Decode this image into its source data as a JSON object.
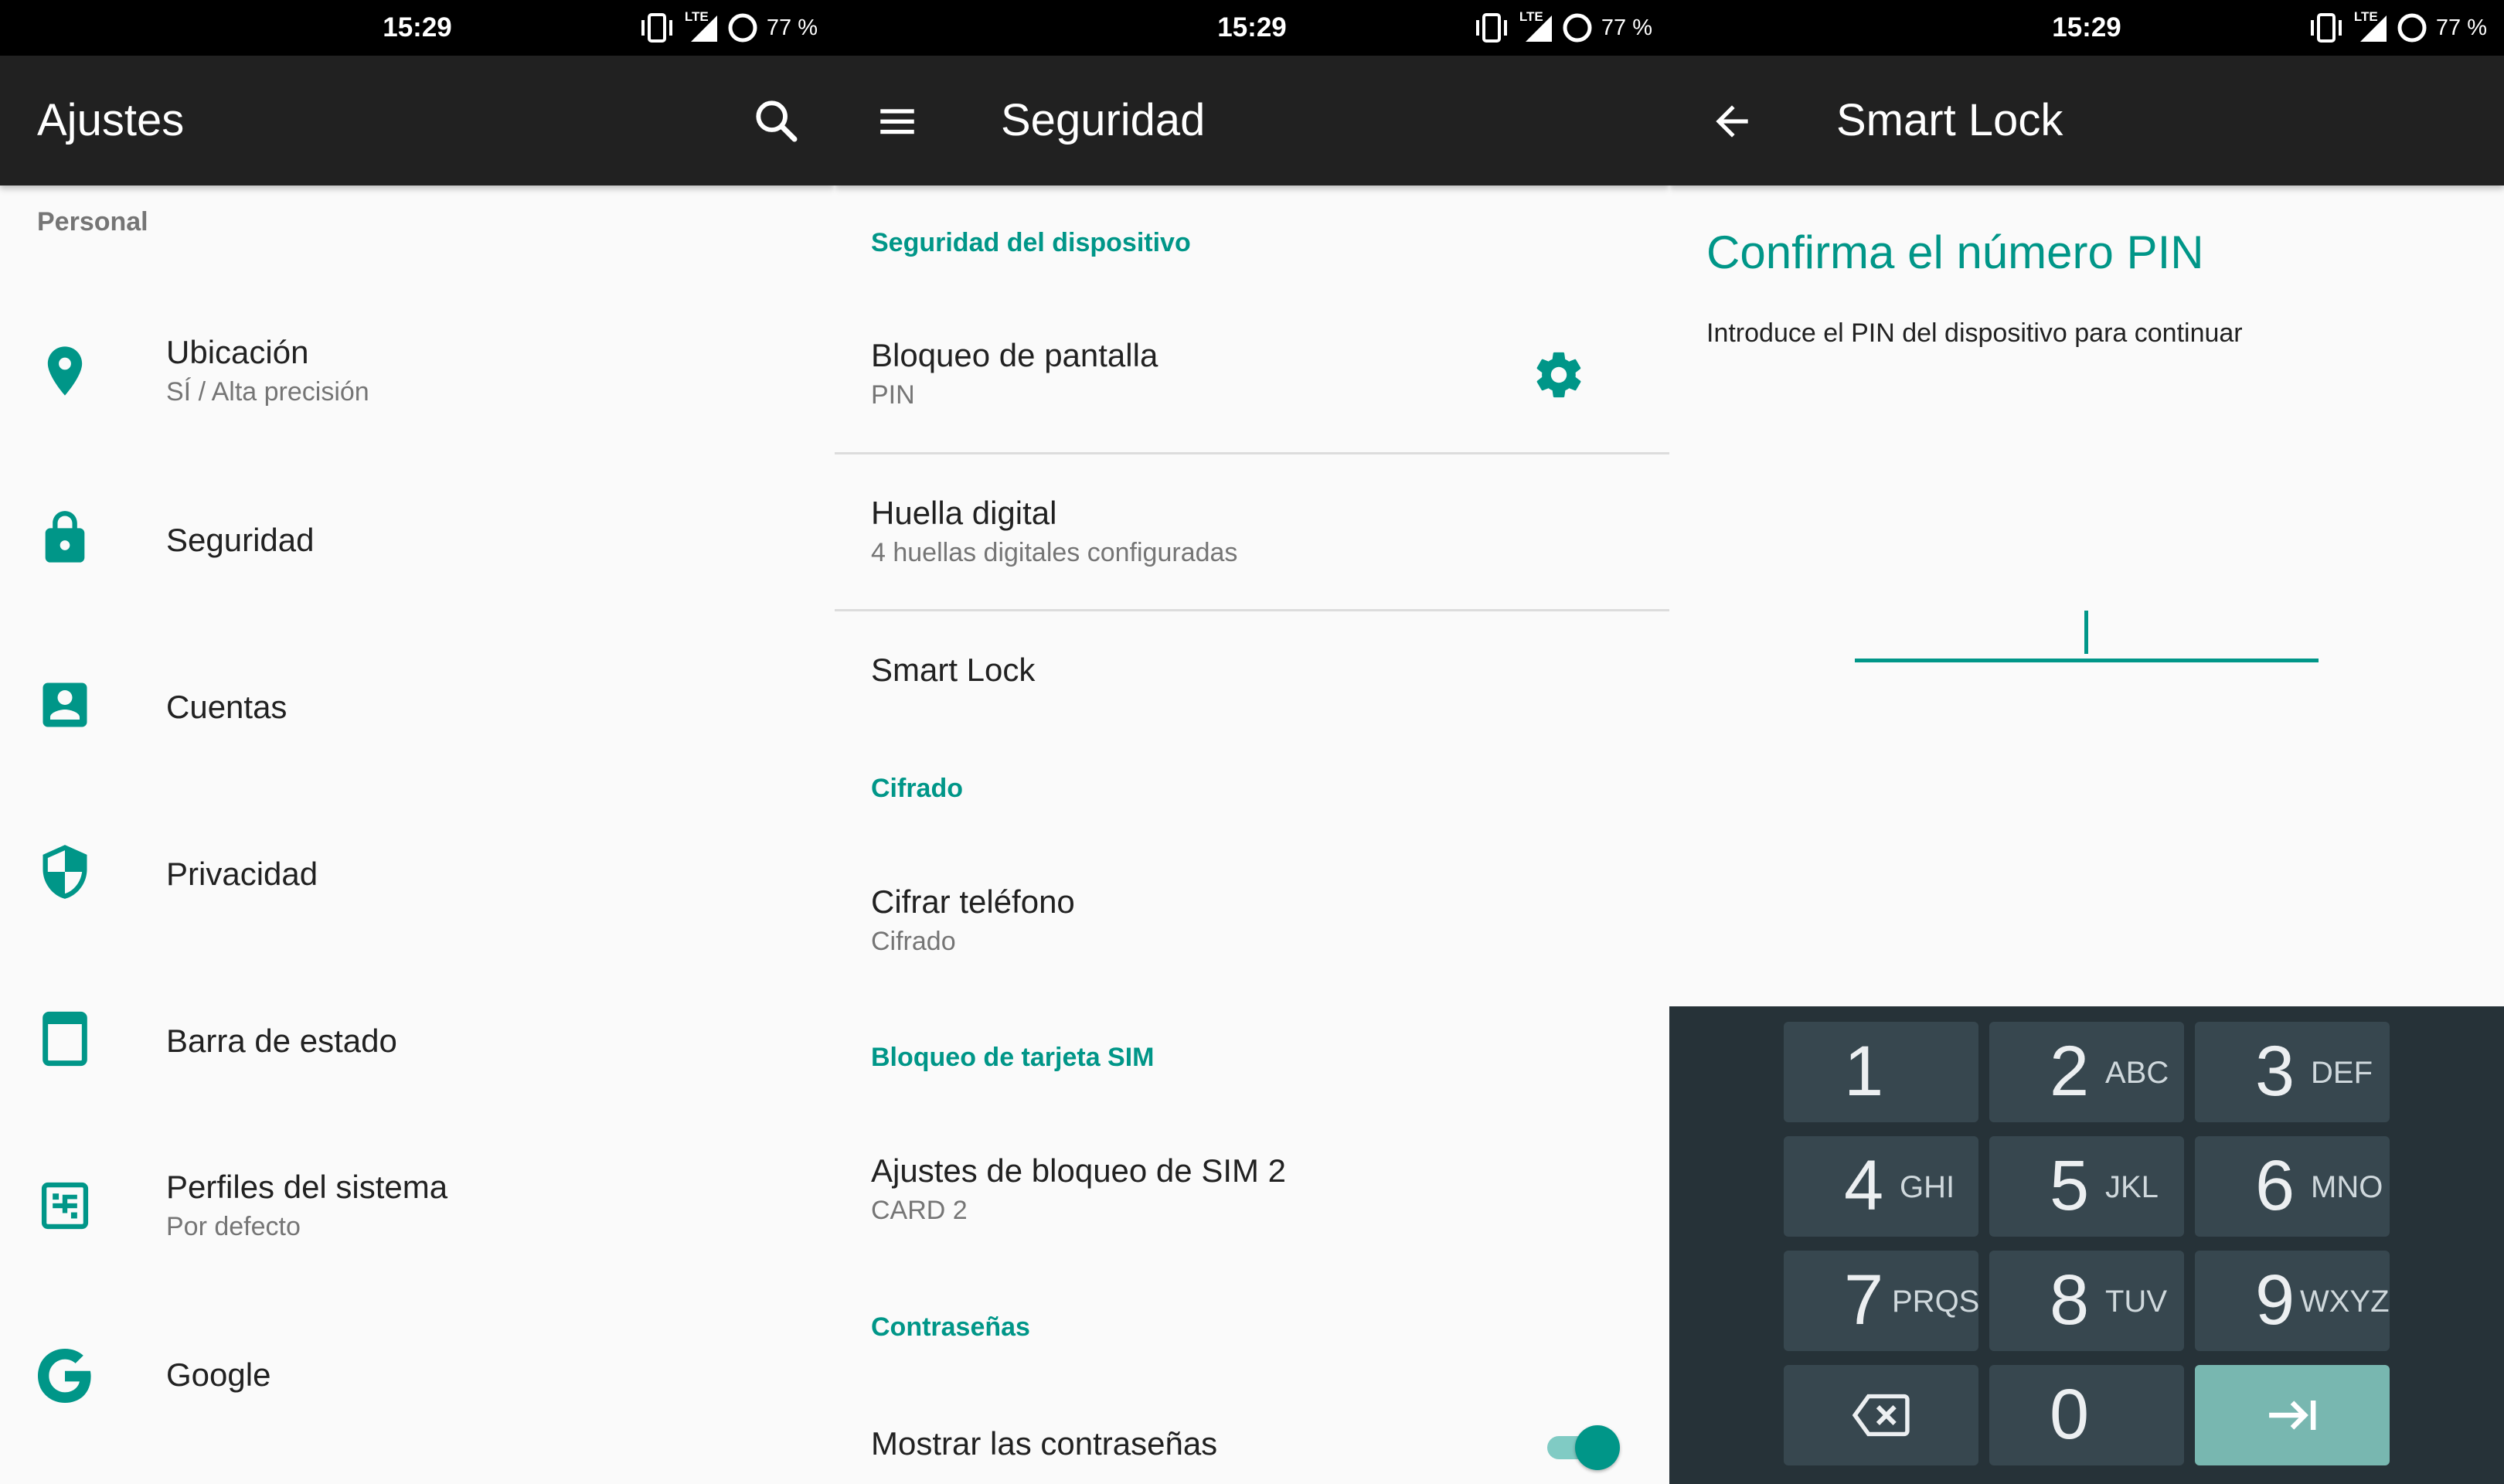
{
  "status_bar": {
    "time": "15:29",
    "network": "LTE",
    "battery": "77 %"
  },
  "panel1": {
    "title": "Ajustes",
    "section": "Personal",
    "items": [
      {
        "label": "Ubicación",
        "sub": "SÍ / Alta precisión",
        "icon": "location-pin-icon"
      },
      {
        "label": "Seguridad",
        "icon": "lock-icon"
      },
      {
        "label": "Cuentas",
        "icon": "account-box-icon"
      },
      {
        "label": "Privacidad",
        "icon": "shield-icon"
      },
      {
        "label": "Barra de estado",
        "icon": "status-bar-icon"
      },
      {
        "label": "Perfiles del sistema",
        "sub": "Por defecto",
        "icon": "profiles-icon"
      },
      {
        "label": "Google",
        "icon": "google-icon"
      }
    ]
  },
  "panel2": {
    "title": "Seguridad",
    "cat_device": "Seguridad del dispositivo",
    "screen_lock": {
      "label": "Bloqueo de pantalla",
      "sub": "PIN"
    },
    "fingerprint": {
      "label": "Huella digital",
      "sub": "4 huellas digitales configuradas"
    },
    "smart_lock": {
      "label": "Smart Lock"
    },
    "cat_encrypt": "Cifrado",
    "encrypt": {
      "label": "Cifrar teléfono",
      "sub": "Cifrado"
    },
    "cat_sim": "Bloqueo de tarjeta SIM",
    "sim": {
      "label": "Ajustes de bloqueo de SIM 2",
      "sub": "CARD 2"
    },
    "cat_pass": "Contraseñas",
    "show_pass": {
      "label": "Mostrar las contraseñas",
      "enabled": true
    }
  },
  "panel3": {
    "title": "Smart Lock",
    "heading": "Confirma el número PIN",
    "desc": "Introduce el PIN del dispositivo para continuar",
    "pin_value": "",
    "keys": [
      {
        "num": "1",
        "letters": ""
      },
      {
        "num": "2",
        "letters": "ABC"
      },
      {
        "num": "3",
        "letters": "DEF"
      },
      {
        "num": "4",
        "letters": "GHI"
      },
      {
        "num": "5",
        "letters": "JKL"
      },
      {
        "num": "6",
        "letters": "MNO"
      },
      {
        "num": "7",
        "letters": "PRQS"
      },
      {
        "num": "8",
        "letters": "TUV"
      },
      {
        "num": "9",
        "letters": "WXYZ"
      },
      {
        "num": "0",
        "letters": ""
      }
    ]
  },
  "colors": {
    "accent": "#009688",
    "appbar": "#212121",
    "keypad_bg": "#263238",
    "key_bg": "#37474f",
    "enter_key": "#78b7b0"
  }
}
